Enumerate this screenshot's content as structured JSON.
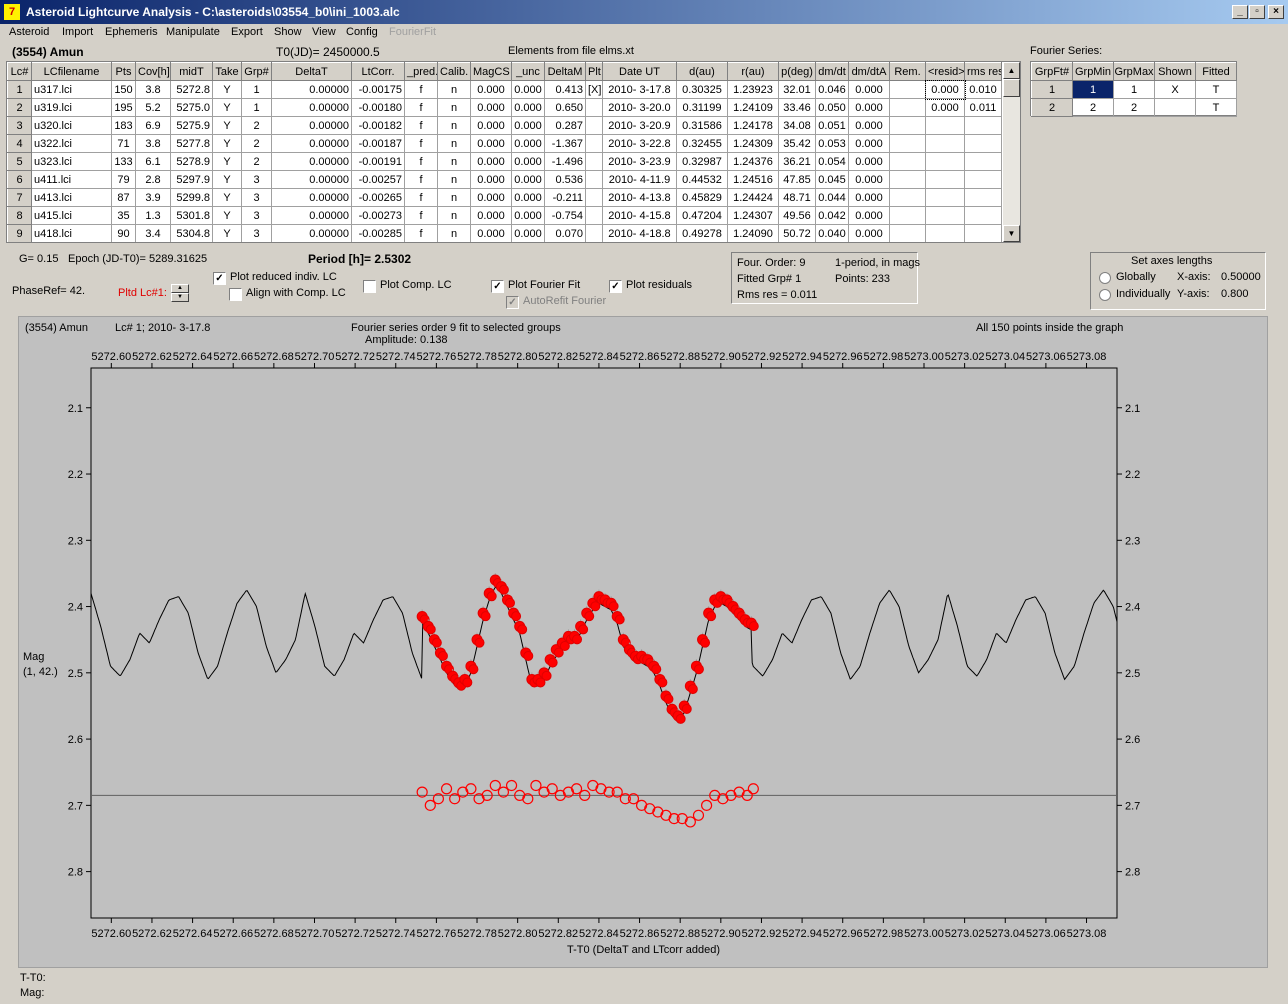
{
  "window": {
    "title": "Asteroid Lightcurve Analysis - C:\\asteroids\\03554_b0\\ini_1003.alc",
    "icon": "app-icon"
  },
  "menu": [
    "Asteroid",
    "Import",
    "Ephemeris",
    "Manipulate",
    "Export",
    "Show",
    "View",
    "Config",
    "FourierFit"
  ],
  "header": {
    "asteroid": "(3554) Amun",
    "t0": "T0(JD)= 2450000.5",
    "elements": "Elements from file elms.xt",
    "fourier_title": "Fourier Series:"
  },
  "lc_table": {
    "columns": [
      "Lc#",
      "LCfilename",
      "Pts",
      "Cov[h]",
      "midT",
      "Take",
      "Grp#",
      "DeltaT",
      "LtCorr.",
      "_pred.",
      "Calib.",
      "MagCS",
      "_unc",
      "DeltaM",
      "Plt",
      "Date UT",
      "d(au)",
      "r(au)",
      "p(deg)",
      "dm/dt",
      "dm/dtA",
      "Rem.",
      "<resid>",
      "rms res"
    ],
    "rows": [
      [
        "1",
        "u317.lci",
        "150",
        "3.8",
        "5272.8",
        "Y",
        "1",
        "0.00000",
        "-0.00175",
        "f",
        "n",
        "0.000",
        "0.000",
        "0.413",
        "[X]",
        "2010- 3-17.8",
        "0.30325",
        "1.23923",
        "32.01",
        "0.046",
        "0.000",
        "",
        "0.000",
        "0.010"
      ],
      [
        "2",
        "u319.lci",
        "195",
        "5.2",
        "5275.0",
        "Y",
        "1",
        "0.00000",
        "-0.00180",
        "f",
        "n",
        "0.000",
        "0.000",
        "0.650",
        "",
        "2010- 3-20.0",
        "0.31199",
        "1.24109",
        "33.46",
        "0.050",
        "0.000",
        "",
        "0.000",
        "0.011"
      ],
      [
        "3",
        "u320.lci",
        "183",
        "6.9",
        "5275.9",
        "Y",
        "2",
        "0.00000",
        "-0.00182",
        "f",
        "n",
        "0.000",
        "0.000",
        "0.287",
        "",
        "2010- 3-20.9",
        "0.31586",
        "1.24178",
        "34.08",
        "0.051",
        "0.000",
        "",
        "",
        ""
      ],
      [
        "4",
        "u322.lci",
        "71",
        "3.8",
        "5277.8",
        "Y",
        "2",
        "0.00000",
        "-0.00187",
        "f",
        "n",
        "0.000",
        "0.000",
        "-1.367",
        "",
        "2010- 3-22.8",
        "0.32455",
        "1.24309",
        "35.42",
        "0.053",
        "0.000",
        "",
        "",
        ""
      ],
      [
        "5",
        "u323.lci",
        "133",
        "6.1",
        "5278.9",
        "Y",
        "2",
        "0.00000",
        "-0.00191",
        "f",
        "n",
        "0.000",
        "0.000",
        "-1.496",
        "",
        "2010- 3-23.9",
        "0.32987",
        "1.24376",
        "36.21",
        "0.054",
        "0.000",
        "",
        "",
        ""
      ],
      [
        "6",
        "u411.lci",
        "79",
        "2.8",
        "5297.9",
        "Y",
        "3",
        "0.00000",
        "-0.00257",
        "f",
        "n",
        "0.000",
        "0.000",
        "0.536",
        "",
        "2010- 4-11.9",
        "0.44532",
        "1.24516",
        "47.85",
        "0.045",
        "0.000",
        "",
        "",
        ""
      ],
      [
        "7",
        "u413.lci",
        "87",
        "3.9",
        "5299.8",
        "Y",
        "3",
        "0.00000",
        "-0.00265",
        "f",
        "n",
        "0.000",
        "0.000",
        "-0.211",
        "",
        "2010- 4-13.8",
        "0.45829",
        "1.24424",
        "48.71",
        "0.044",
        "0.000",
        "",
        "",
        ""
      ],
      [
        "8",
        "u415.lci",
        "35",
        "1.3",
        "5301.8",
        "Y",
        "3",
        "0.00000",
        "-0.00273",
        "f",
        "n",
        "0.000",
        "0.000",
        "-0.754",
        "",
        "2010- 4-15.8",
        "0.47204",
        "1.24307",
        "49.56",
        "0.042",
        "0.000",
        "",
        "",
        ""
      ],
      [
        "9",
        "u418.lci",
        "90",
        "3.4",
        "5304.8",
        "Y",
        "3",
        "0.00000",
        "-0.00285",
        "f",
        "n",
        "0.000",
        "0.000",
        "0.070",
        "",
        "2010- 4-18.8",
        "0.49278",
        "1.24090",
        "50.72",
        "0.040",
        "0.000",
        "",
        "",
        ""
      ]
    ]
  },
  "fourier_table": {
    "columns": [
      "GrpFt#",
      "GrpMin",
      "GrpMax",
      "Shown",
      "Fitted"
    ],
    "rows": [
      [
        "1",
        "1",
        "1",
        "X",
        "T"
      ],
      [
        "2",
        "2",
        "2",
        "",
        "T"
      ]
    ]
  },
  "controls": {
    "g": "G= 0.15",
    "epoch": "Epoch (JD-T0)= 5289.31625",
    "period": "Period [h]= 2.5302",
    "phaseref": "PhaseRef= 42.",
    "pltd": "Pltd Lc#1:",
    "cb_reduced": "Plot reduced indiv. LC",
    "cb_align": "Align with Comp. LC",
    "cb_comp": "Plot Comp. LC",
    "cb_fourier": "Plot Fourier Fit",
    "cb_autorefit": "AutoRefit Fourier",
    "cb_resid": "Plot residuals",
    "info": {
      "order": "Four. Order:  9",
      "period_note": "1-period, in mags",
      "fitted": "Fitted Grp# 1",
      "points": "Points: 233",
      "rms": "Rms res     = 0.011"
    },
    "axes": {
      "title": "Set axes lengths",
      "globally": "Globally",
      "individually": "Individually",
      "xaxis": "X-axis:",
      "xval": "0.50000",
      "yaxis": "Y-axis:",
      "yval": "0.800"
    }
  },
  "plot": {
    "name": "(3554) Amun",
    "lc": "Lc# 1; 2010- 3-17.8",
    "caption": "Fourier series order 9 fit to selected groups",
    "amplitude": "Amplitude: 0.138",
    "inside": "All 150 points inside the graph",
    "ylabel": "Mag",
    "ylabel2": "(1, 42.)",
    "xlabel": "T-T0 (DeltaT and LTcorr added)"
  },
  "footer": {
    "t": "T-T0:",
    "mag": "Mag:"
  },
  "chart_data": {
    "type": "scatter",
    "xlim": [
      5272.59,
      5273.095
    ],
    "ylim": [
      2.87,
      2.04
    ],
    "y_reversed": true,
    "x_ticks": [
      "5272.60",
      "5272.62",
      "5272.64",
      "5272.66",
      "5272.68",
      "5272.70",
      "5272.72",
      "5272.74",
      "5272.76",
      "5272.78",
      "5272.80",
      "5272.82",
      "5272.84",
      "5272.86",
      "5272.88",
      "5272.90",
      "5272.92",
      "5272.94",
      "5272.96",
      "5272.98",
      "5273.00",
      "5273.02",
      "5273.04",
      "5273.06",
      "5273.08"
    ],
    "x_tick_values": [
      5272.6,
      5272.62,
      5272.64,
      5272.66,
      5272.68,
      5272.7,
      5272.72,
      5272.74,
      5272.76,
      5272.78,
      5272.8,
      5272.82,
      5272.84,
      5272.86,
      5272.88,
      5272.9,
      5272.92,
      5272.94,
      5272.96,
      5272.98,
      5273.0,
      5273.02,
      5273.04,
      5273.06,
      5273.08
    ],
    "y_ticks": [
      "2.1",
      "2.2",
      "2.3",
      "2.4",
      "2.5",
      "2.6",
      "2.7",
      "2.8"
    ],
    "y_tick_values": [
      2.1,
      2.2,
      2.3,
      2.4,
      2.5,
      2.6,
      2.7,
      2.8
    ],
    "residual_baseline": 2.685,
    "fourier_curve": {
      "period_days": 0.105425,
      "x": [
        5272.59,
        5272.595,
        5272.6,
        5272.605,
        5272.61,
        5272.615,
        5272.62,
        5272.625,
        5272.63,
        5272.635,
        5272.64,
        5272.645,
        5272.65,
        5272.655,
        5272.66,
        5272.665,
        5272.67,
        5272.675,
        5272.68,
        5272.685,
        5272.69,
        5272.695
      ],
      "y": [
        2.38,
        2.43,
        2.49,
        2.505,
        2.48,
        2.44,
        2.455,
        2.42,
        2.39,
        2.385,
        2.41,
        2.47,
        2.51,
        2.49,
        2.44,
        2.395,
        2.375,
        2.4,
        2.46,
        2.5,
        2.48,
        2.45
      ]
    },
    "observations": {
      "x": [
        5272.753,
        5272.756,
        5272.759,
        5272.762,
        5272.765,
        5272.768,
        5272.771,
        5272.774,
        5272.777,
        5272.78,
        5272.783,
        5272.786,
        5272.789,
        5272.792,
        5272.795,
        5272.798,
        5272.801,
        5272.804,
        5272.807,
        5272.81,
        5272.813,
        5272.816,
        5272.819,
        5272.822,
        5272.825,
        5272.828,
        5272.831,
        5272.834,
        5272.837,
        5272.84,
        5272.843,
        5272.846,
        5272.849,
        5272.852,
        5272.855,
        5272.858,
        5272.861,
        5272.864,
        5272.867,
        5272.87,
        5272.873,
        5272.876,
        5272.879,
        5272.882,
        5272.885,
        5272.888,
        5272.891,
        5272.894,
        5272.897,
        5272.9,
        5272.903,
        5272.906,
        5272.909,
        5272.912,
        5272.915
      ],
      "y": [
        2.415,
        2.43,
        2.45,
        2.47,
        2.49,
        2.505,
        2.515,
        2.51,
        2.49,
        2.45,
        2.41,
        2.38,
        2.36,
        2.37,
        2.39,
        2.41,
        2.43,
        2.47,
        2.51,
        2.51,
        2.5,
        2.48,
        2.465,
        2.455,
        2.445,
        2.445,
        2.43,
        2.41,
        2.395,
        2.385,
        2.39,
        2.395,
        2.415,
        2.45,
        2.465,
        2.475,
        2.475,
        2.48,
        2.49,
        2.51,
        2.535,
        2.555,
        2.565,
        2.55,
        2.52,
        2.49,
        2.45,
        2.41,
        2.39,
        2.385,
        2.39,
        2.4,
        2.41,
        2.42,
        2.425
      ]
    },
    "residuals": {
      "x": [
        5272.753,
        5272.757,
        5272.761,
        5272.765,
        5272.769,
        5272.773,
        5272.777,
        5272.781,
        5272.785,
        5272.789,
        5272.793,
        5272.797,
        5272.801,
        5272.805,
        5272.809,
        5272.813,
        5272.817,
        5272.821,
        5272.825,
        5272.829,
        5272.833,
        5272.837,
        5272.841,
        5272.845,
        5272.849,
        5272.853,
        5272.857,
        5272.861,
        5272.865,
        5272.869,
        5272.873,
        5272.877,
        5272.881,
        5272.885,
        5272.889,
        5272.893,
        5272.897,
        5272.901,
        5272.905,
        5272.909,
        5272.913,
        5272.916
      ],
      "y": [
        2.68,
        2.7,
        2.69,
        2.675,
        2.69,
        2.68,
        2.675,
        2.69,
        2.685,
        2.67,
        2.68,
        2.67,
        2.685,
        2.69,
        2.67,
        2.68,
        2.675,
        2.685,
        2.68,
        2.675,
        2.685,
        2.67,
        2.675,
        2.68,
        2.68,
        2.69,
        2.69,
        2.7,
        2.705,
        2.71,
        2.715,
        2.72,
        2.72,
        2.725,
        2.715,
        2.7,
        2.685,
        2.69,
        2.685,
        2.68,
        2.685,
        2.675
      ]
    }
  }
}
